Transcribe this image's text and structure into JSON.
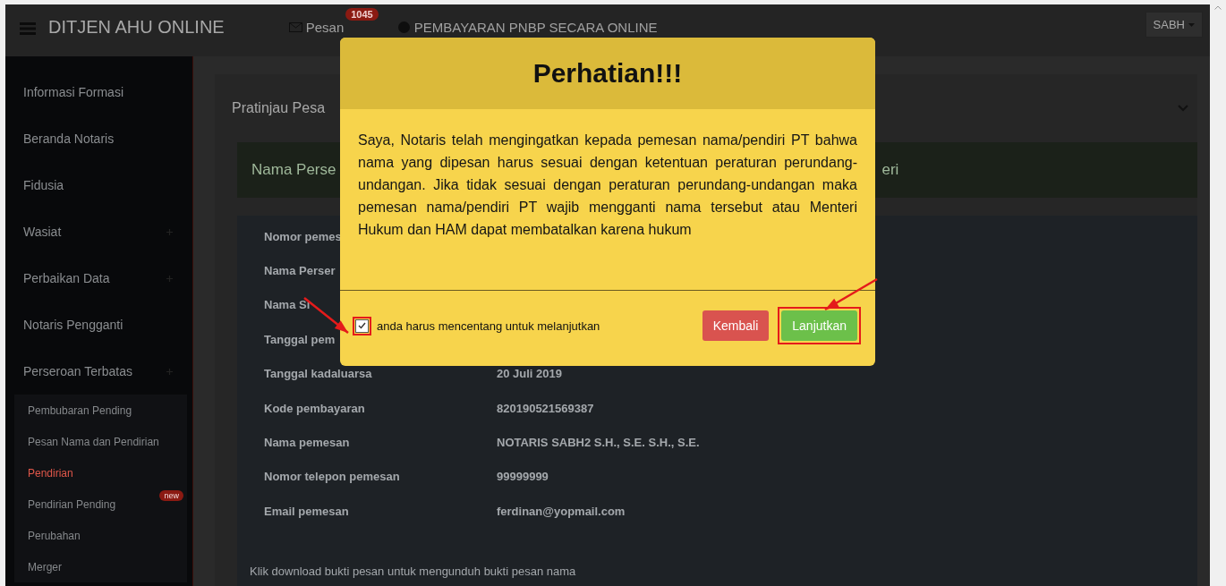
{
  "header": {
    "brand": "DITJEN AHU ONLINE",
    "messages": {
      "label": "Pesan",
      "count": "1045"
    },
    "payment_link": "PEMBAYARAN PNBP SECARA ONLINE",
    "user": "SABH"
  },
  "sidebar": {
    "items": [
      {
        "label": "Informasi Formasi",
        "expandable": false
      },
      {
        "label": "Beranda Notaris",
        "expandable": false
      },
      {
        "label": "Fidusia",
        "expandable": false
      },
      {
        "label": "Wasiat",
        "expandable": true
      },
      {
        "label": "Perbaikan Data",
        "expandable": true
      },
      {
        "label": "Notaris Pengganti",
        "expandable": false
      },
      {
        "label": "Perseroan Terbatas",
        "expandable": true,
        "children": [
          {
            "label": "Pembubaran Pending",
            "selected": false
          },
          {
            "label": "Pesan Nama dan Pendirian",
            "selected": false
          },
          {
            "label": "Pendirian",
            "selected": true
          },
          {
            "label": "Pendirian Pending",
            "selected": false,
            "badge": "new"
          },
          {
            "label": "Perubahan",
            "selected": false
          },
          {
            "label": "Merger",
            "selected": false
          }
        ]
      }
    ]
  },
  "content": {
    "panel_title": "Pratinjau Pesa",
    "alert": {
      "text_left": "Nama Perse",
      "text_right": "eri"
    },
    "details": [
      {
        "label": "Nomor pemes"
      },
      {
        "label": "Nama Perser"
      },
      {
        "label": "Nama Si"
      },
      {
        "label": "Tanggal pem"
      },
      {
        "label": "Tanggal kadaluarsa",
        "value": "20 Juli 2019"
      },
      {
        "label": "Kode pembayaran",
        "value": "820190521569387"
      },
      {
        "label": "Nama pemesan",
        "value": "NOTARIS SABH2 S.H., S.E. S.H., S.E."
      },
      {
        "label": "Nomor telepon pemesan",
        "value": "99999999"
      },
      {
        "label": "Email pemesan",
        "value": "ferdinan@yopmail.com"
      }
    ],
    "note": "Klik download bukti pesan untuk mengunduh bukti pesan nama"
  },
  "modal": {
    "title": "Perhatian!!!",
    "message": "Saya, Notaris telah mengingatkan kepada pemesan nama/pendiri PT bahwa nama yang dipesan harus sesuai dengan ketentuan peraturan perundang-undangan. Jika tidak sesuai dengan peraturan perundang-undangan maka pemesan nama/pendiri PT wajib mengganti nama tersebut atau Menteri Hukum dan HAM dapat membatalkan karena hukum",
    "confirm": {
      "label": "anda harus mencentang untuk melanjutkan",
      "checked": true,
      "highlighted": true
    },
    "buttons": [
      {
        "label": "Kembali",
        "kind": "danger",
        "highlighted": false
      },
      {
        "label": "Lanjutkan",
        "kind": "success",
        "highlighted": true
      }
    ]
  }
}
